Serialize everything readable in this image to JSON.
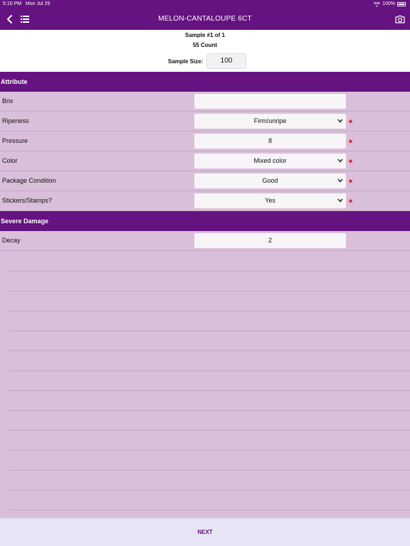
{
  "status_bar": {
    "time": "5:10 PM",
    "date": "Mon Jul 29",
    "battery": "100%"
  },
  "nav": {
    "title": "MELON-CANTALOUPE 6CT"
  },
  "sample": {
    "number_text": "Sample #1 of 1",
    "count_text": "55 Count",
    "size_label": "Sample Size:",
    "size_value": "100"
  },
  "sections": {
    "attribute": "Attribute",
    "severe_damage": "Severe Damage"
  },
  "attributes": [
    {
      "label": "Brix",
      "value": "",
      "type": "input",
      "required": false
    },
    {
      "label": "Ripeness",
      "value": "Firm/unripe",
      "type": "select",
      "required": true
    },
    {
      "label": "Pressure",
      "value": "8",
      "type": "input",
      "required": true
    },
    {
      "label": "Color",
      "value": "Mixed color",
      "type": "select",
      "required": true
    },
    {
      "label": "Package Condition",
      "value": "Good",
      "type": "select",
      "required": true
    },
    {
      "label": "Stickers/Stamps?",
      "value": "Yes",
      "type": "select",
      "required": true
    }
  ],
  "severe_damage": [
    {
      "label": "Decay",
      "value": "2",
      "type": "input",
      "required": false
    }
  ],
  "footer": {
    "next_label": "NEXT"
  },
  "colors": {
    "brand_purple": "#651380",
    "row_background": "#d9bfd9",
    "required_star": "#e0101a",
    "footer_background": "#e6e4f5"
  }
}
